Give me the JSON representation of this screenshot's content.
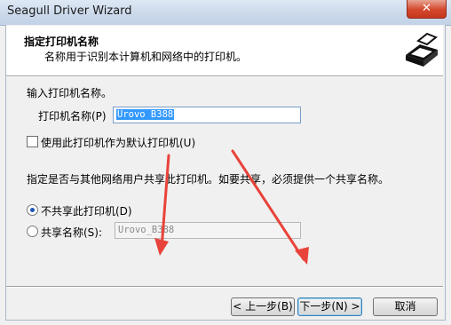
{
  "window": {
    "title": "Seagull Driver Wizard",
    "close_symbol": "✕"
  },
  "header": {
    "title": "指定打印机名称",
    "subtitle": "名称用于识别本计算机和网络中的打印机。",
    "icon": "printer-icon"
  },
  "form": {
    "intro": "输入打印机名称。",
    "printer_name_label": "打印机名称(P)",
    "printer_name_value": "Urovo B388",
    "default_checkbox_label": "使用此打印机作为默认打印机(U)",
    "default_checked": false,
    "share_instruction": "指定是否与其他网络用户共享此打印机。如要共享，必须提供一个共享名称。",
    "no_share_label": "不共享此打印机(D)",
    "no_share_selected": true,
    "share_label": "共享名称(S):",
    "share_name_value": "Urovo_B388"
  },
  "buttons": {
    "back": "< 上一步(B)",
    "next": "下一步(N) >",
    "cancel": "取消"
  },
  "annotation": {
    "arrow_color": "#e8433a"
  }
}
